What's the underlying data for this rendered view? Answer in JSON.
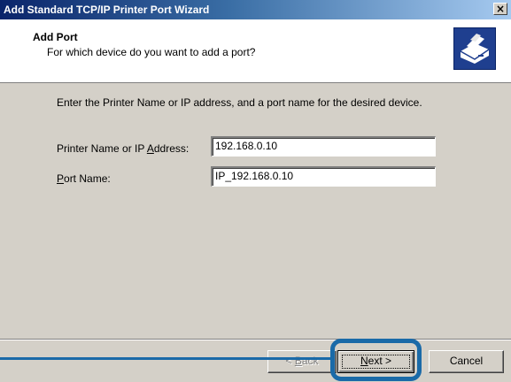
{
  "window": {
    "title": "Add Standard TCP/IP Printer Port Wizard",
    "close_glyph": "×"
  },
  "header": {
    "title": "Add Port",
    "subtitle": "For which device do you want to add a port?",
    "icon": "printer-wizard-icon"
  },
  "content": {
    "instruction": "Enter the Printer Name or IP address, and a port name for the desired device.",
    "printer_label_before": "Printer Name or IP ",
    "printer_label_accel": "A",
    "printer_label_after": "ddress:",
    "printer_value": "192.168.0.10",
    "port_label_accel": "P",
    "port_label_after": "ort Name:",
    "port_value": "IP_192.168.0.10"
  },
  "buttons": {
    "back_lt": "< ",
    "back_accel": "B",
    "back_rest": "ack",
    "next_accel": "N",
    "next_rest": "ext >",
    "cancel": "Cancel"
  },
  "colors": {
    "title_gradient_start": "#0a246a",
    "title_gradient_end": "#a6caf0",
    "highlight": "#1a6aa8",
    "dialog_face": "#d4d0c8"
  }
}
